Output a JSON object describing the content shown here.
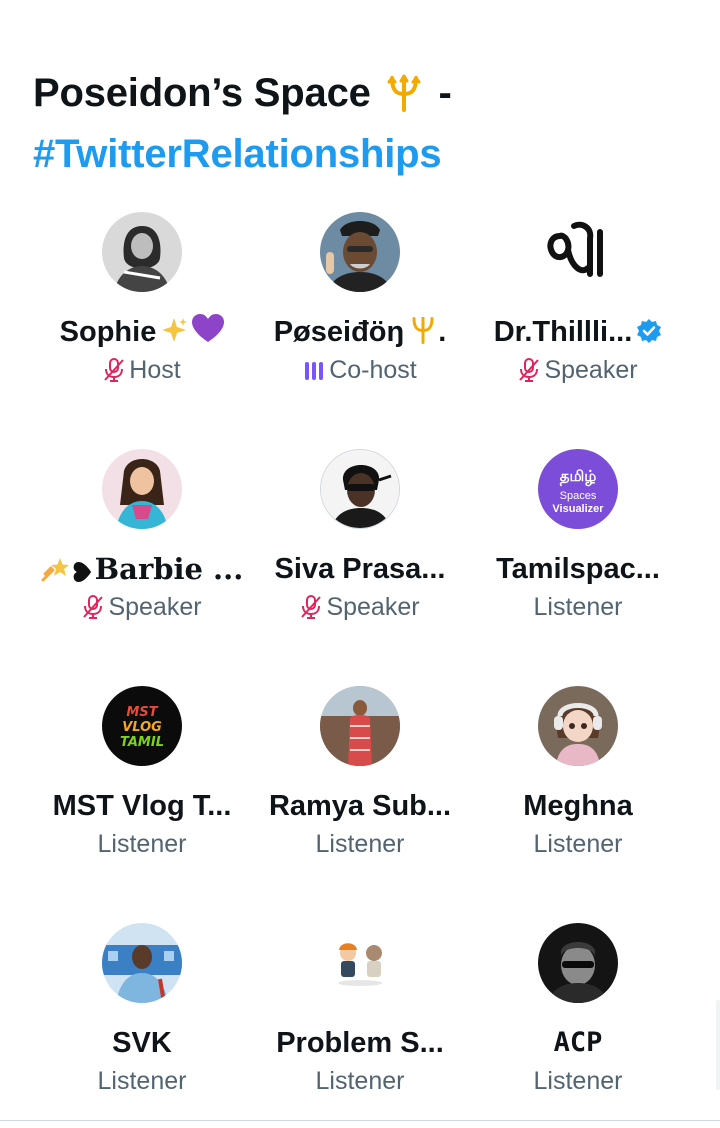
{
  "space": {
    "title_line1": "Poseidon’s Space",
    "title_sep": "-",
    "hashtag": "#TwitterRelationships"
  },
  "colors": {
    "accent": "#1d9bf0",
    "muted_mic": "#e0245e",
    "cohost_wave": "#7856ff",
    "secondary_text": "#536471"
  },
  "participants": [
    {
      "name": "Sophie",
      "role": "Host",
      "mic": "muted",
      "icons": [
        "sparkles-icon",
        "purple-heart-icon"
      ]
    },
    {
      "name": "Pøseiđöŋ",
      "role": "Co-host",
      "mic": "speaking",
      "icons": [
        "trident-icon"
      ]
    },
    {
      "name": "Dr.Thillli...",
      "role": "Speaker",
      "mic": "muted",
      "icons": [
        "verified-badge-icon"
      ]
    },
    {
      "name": "Barbie ...",
      "role": "Speaker",
      "mic": "muted",
      "icons": [
        "shooting-star-icon",
        "heart-icon"
      ]
    },
    {
      "name": "Siva Prasa...",
      "role": "Speaker",
      "mic": "muted"
    },
    {
      "name": "Tamilspac...",
      "role": "Listener",
      "avatar_text": [
        "தமிழ்",
        "Spaces",
        "Visualizer"
      ]
    },
    {
      "name": "MST Vlog T...",
      "role": "Listener",
      "avatar_text": [
        "MST",
        "VLOG",
        "TAMIL"
      ]
    },
    {
      "name": "Ramya Sub...",
      "role": "Listener"
    },
    {
      "name": "Meghna",
      "role": "Listener"
    },
    {
      "name": "SVK",
      "role": "Listener"
    },
    {
      "name": "Problem S...",
      "role": "Listener"
    },
    {
      "name": "ACP",
      "role": "Listener"
    }
  ]
}
